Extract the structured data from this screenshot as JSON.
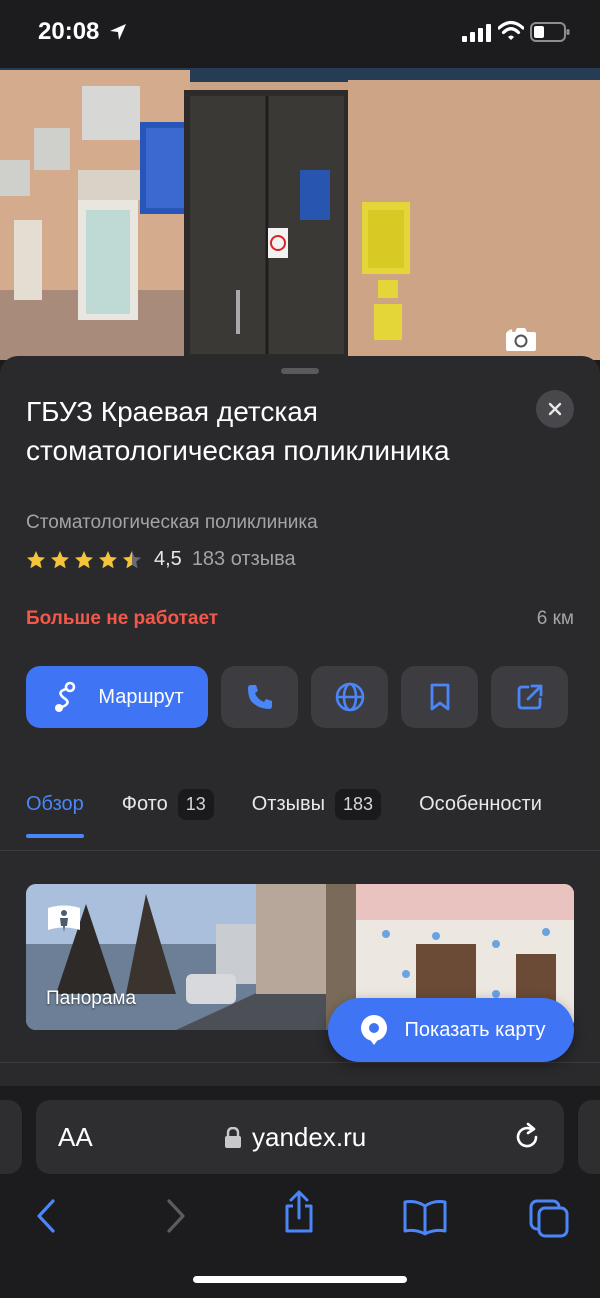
{
  "status": {
    "time": "20:08"
  },
  "hero": {
    "photo_count": "13"
  },
  "place": {
    "title": "ГБУЗ Краевая детская стоматологическая поликлиника",
    "category": "Стоматологическая поликлиника",
    "rating": "4,5",
    "rating_stars": 4.5,
    "reviews": "183 отзыва",
    "status": "Больше не работает",
    "distance": "6 км"
  },
  "actions": {
    "route_label": "Маршрут",
    "icons": [
      "phone-icon",
      "globe-icon",
      "bookmark-icon",
      "share-icon"
    ]
  },
  "tabs": [
    {
      "label": "Обзор",
      "badge": ""
    },
    {
      "label": "Фото",
      "badge": "13"
    },
    {
      "label": "Отзывы",
      "badge": "183"
    },
    {
      "label": "Особенности",
      "badge": ""
    }
  ],
  "panorama": {
    "label": "Панорама"
  },
  "show_map": {
    "label": "Показать карту"
  },
  "browser": {
    "text_size": "AA",
    "url": "yandex.ru"
  },
  "colors": {
    "accent": "#3f74f5",
    "closed": "#f2594b",
    "sheet": "#2a2a2d",
    "star": "#f5c33b"
  }
}
